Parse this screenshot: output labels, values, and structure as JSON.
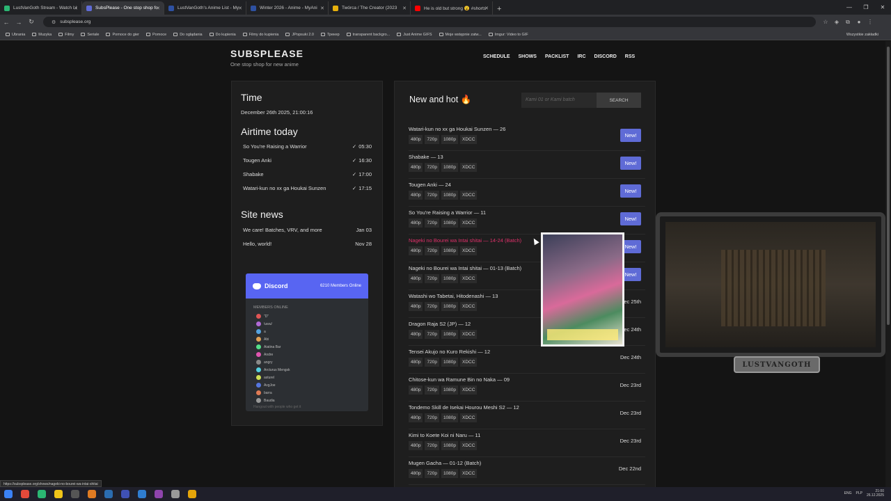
{
  "browser": {
    "tabs": [
      {
        "label": "LustVanGoth Stream - Watch Li",
        "color": "#2bb673",
        "active": false
      },
      {
        "label": "SubsPlease - One stop shop fo",
        "color": "#5f6bd6",
        "active": true
      },
      {
        "label": "LustVanGoth's Anime List - My",
        "color": "#2e51a2",
        "active": false
      },
      {
        "label": "Winter 2026 - Anime - MyAni",
        "color": "#2e51a2",
        "active": false
      },
      {
        "label": "Twórca / The Creator (2023",
        "color": "#e8b10c",
        "active": false
      },
      {
        "label": "He is old but strong 😮 #shorts",
        "color": "#ff0000",
        "active": false
      }
    ],
    "url": "subsplease.org",
    "bookmarks": [
      "Ubrania",
      "Muzyka",
      "Filmy",
      "Seriale",
      "Pomoce do gier",
      "Pomoce",
      "Do oglądania",
      "Do kupienia",
      "Filmy do kupienia",
      "JPopsuki 2.0",
      "Трекер",
      "transparent backgro...",
      "Just Anime GIFS",
      "Moje wstępnie zatw...",
      "Imgur: Video to GIF"
    ],
    "bookmarks_right": "Wszystkie zakładki"
  },
  "site": {
    "logo": "SUBSPLEASE",
    "tagline": "One stop shop for new anime",
    "nav": [
      "SCHEDULE",
      "SHOWS",
      "PACKLIST",
      "IRC",
      "DISCORD",
      "RSS"
    ]
  },
  "sidebar": {
    "time_heading": "Time",
    "time_value": "December 26th 2025, 21:00:16",
    "airtime_heading": "Airtime today",
    "airtime": [
      {
        "title": "So You're Raising a Warrior",
        "time": "05:30"
      },
      {
        "title": "Tougen Anki",
        "time": "16:30"
      },
      {
        "title": "Shabake",
        "time": "17:00"
      },
      {
        "title": "Watari-kun no xx ga Houkai Sunzen",
        "time": "17:15"
      }
    ],
    "check_glyph": "✓",
    "news_heading": "Site news",
    "news": [
      {
        "title": "We care! Batches, VRV, and more",
        "date": "Jan 03"
      },
      {
        "title": "Hello, world!",
        "date": "Nov 28"
      }
    ],
    "discord": {
      "label": "Discord",
      "members_count": "6210 Members Online",
      "members_title": "MEMBERS ONLINE",
      "members": [
        "\"D\"",
        "\\uwu/",
        "a",
        "Abi",
        "Aiatina Bar",
        "Andre",
        "angry",
        "Arcturus Mengsk",
        "asturel",
        "AvgJoe",
        "barra",
        "Baudia"
      ],
      "footer": "Hangout with people who get it"
    }
  },
  "main": {
    "heading": "New and hot 🔥",
    "search_placeholder": "Kami 01 or Kami batch",
    "search_button": "SEARCH",
    "quality_links": [
      "480p",
      "720p",
      "1080p",
      "XDCC"
    ],
    "releases": [
      {
        "title": "Watari-kun no xx ga Houkai Sunzen — 26",
        "status": "New!",
        "is_new": true
      },
      {
        "title": "Shabake — 13",
        "status": "New!",
        "is_new": true
      },
      {
        "title": "Tougen Anki — 24",
        "status": "New!",
        "is_new": true
      },
      {
        "title": "So You're Raising a Warrior — 11",
        "status": "New!",
        "is_new": true
      },
      {
        "title": "Nageki no Bourei wa Intai shitai — 14-24 (Batch)",
        "status": "New!",
        "is_new": true,
        "hover": true
      },
      {
        "title": "Nageki no Bourei wa Intai shitai — 01-13 (Batch)",
        "status": "New!",
        "is_new": true
      },
      {
        "title": "Watashi wo Tabetai, Hitodenashi — 13",
        "status": "Dec 25th",
        "is_new": false
      },
      {
        "title": "Dragon Raja S2 (JP) — 12",
        "status": "Dec 24th",
        "is_new": false
      },
      {
        "title": "Tensei Akujo no Kuro Rekishi — 12",
        "status": "Dec 24th",
        "is_new": false
      },
      {
        "title": "Chitose-kun wa Ramune Bin no Naka — 09",
        "status": "Dec 23rd",
        "is_new": false
      },
      {
        "title": "Tondemo Skill de Isekai Hourou Meshi S2 — 12",
        "status": "Dec 23rd",
        "is_new": false
      },
      {
        "title": "Kimi to Koete Koi ni Naru — 11",
        "status": "Dec 23rd",
        "is_new": false
      },
      {
        "title": "Mugen Gacha — 01-12 (Batch)",
        "status": "Dec 22nd",
        "is_new": false
      }
    ]
  },
  "overlay": {
    "nameplate": "LUSTVANGOTH",
    "status_link": "https://subsplease.org/shows/nageki-no-bourei-wa-intai-shitai"
  },
  "taskbar": {
    "lang": "ENG",
    "region": "PLP",
    "time": "21:00",
    "date": "26.12.2025"
  }
}
